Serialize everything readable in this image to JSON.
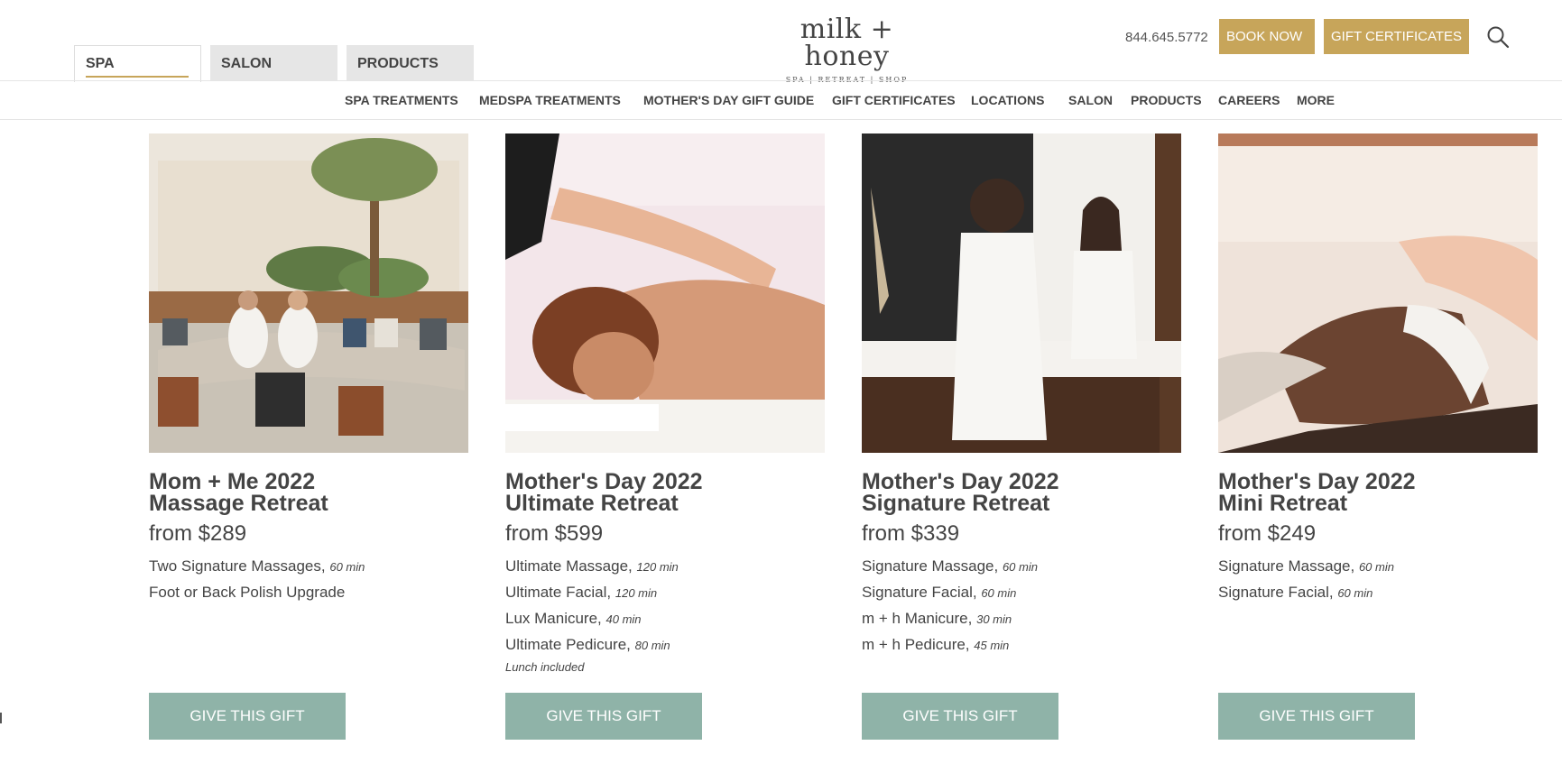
{
  "header": {
    "tabs": [
      {
        "label": "SPA",
        "active": true
      },
      {
        "label": "SALON",
        "active": false
      },
      {
        "label": "PRODUCTS",
        "active": false
      }
    ],
    "logo": {
      "name": "milk + honey",
      "tagline": "SPA | RETREAT | SHOP"
    },
    "phone": "844.645.5772",
    "book_now": "BOOK NOW",
    "gift_certificates": "GIFT CERTIFICATES",
    "search_icon": "search-icon"
  },
  "nav": {
    "items": [
      "SPA TREATMENTS",
      "MEDSPA TREATMENTS",
      "MOTHER'S DAY GIFT GUIDE",
      "GIFT CERTIFICATES",
      "LOCATIONS",
      "SALON",
      "PRODUCTS",
      "CAREERS",
      "MORE"
    ]
  },
  "cards": [
    {
      "title_line1": "Mom + Me 2022",
      "title_line2": "Massage Retreat",
      "price": "from $289",
      "items": [
        {
          "name": "Two Signature Massages,",
          "duration": "60 min"
        },
        {
          "name": "Foot or Back Polish Upgrade",
          "duration": ""
        }
      ],
      "note": "",
      "button": "GIVE THIS GIFT"
    },
    {
      "title_line1": "Mother's Day 2022",
      "title_line2": "Ultimate Retreat",
      "price": "from $599",
      "items": [
        {
          "name": "Ultimate Massage,",
          "duration": "120 min"
        },
        {
          "name": "Ultimate Facial,",
          "duration": "120 min"
        },
        {
          "name": "Lux Manicure,",
          "duration": "40 min"
        },
        {
          "name": "Ultimate Pedicure,",
          "duration": "80 min"
        }
      ],
      "note": "Lunch included",
      "button": "GIVE THIS GIFT"
    },
    {
      "title_line1": "Mother's Day 2022",
      "title_line2": "Signature Retreat",
      "price": "from $339",
      "items": [
        {
          "name": "Signature Massage,",
          "duration": "60 min"
        },
        {
          "name": "Signature Facial,",
          "duration": "60 min"
        },
        {
          "name": "m + h Manicure,",
          "duration": "30 min"
        },
        {
          "name": "m + h Pedicure,",
          "duration": "45 min"
        }
      ],
      "note": "",
      "button": "GIVE THIS GIFT"
    },
    {
      "title_line1": "Mother's Day 2022",
      "title_line2": "Mini Retreat",
      "price": "from $249",
      "items": [
        {
          "name": "Signature Massage,",
          "duration": "60 min"
        },
        {
          "name": "Signature Facial,",
          "duration": "60 min"
        }
      ],
      "note": "",
      "button": "GIVE THIS GIFT"
    }
  ],
  "colors": {
    "gold": "#c7a55a",
    "sage": "#8fb3a8",
    "text": "#444444"
  }
}
